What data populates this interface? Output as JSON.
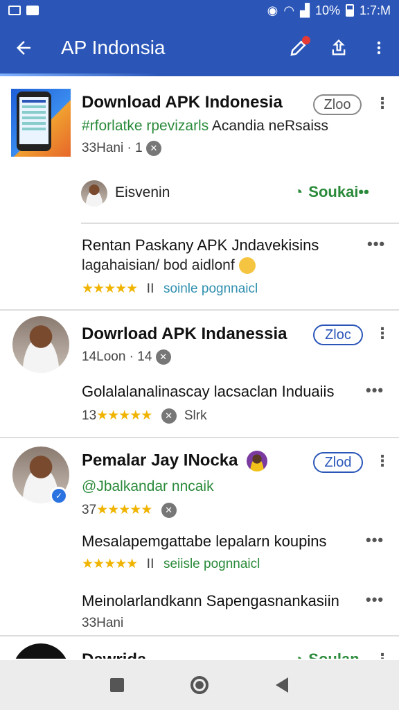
{
  "status_bar": {
    "battery": "10%",
    "time": "1:7:M"
  },
  "app_bar": {
    "title": "AP Indonsia",
    "back_icon": "arrow-left-icon",
    "actions": [
      "edit-icon",
      "share-icon",
      "more-vert-icon"
    ]
  },
  "items": {
    "first": {
      "title": "Download APK Indonesia",
      "tag": "Zloo",
      "subtitle_green": "#rforlatke rpevizarls",
      "subtitle_dark": "Acandia neRsaiss",
      "meta_left": "33Hani ·",
      "meta_num": "1",
      "author": "Eisvenin",
      "follow": "Soukai••"
    },
    "second": {
      "title": "Rentan Paskany APK Jndavekisins",
      "subtitle": "lagahaisian/ bod aidlonf",
      "stars_right": "ⅠⅠ",
      "stars_text": "soinle pognnaicl"
    },
    "third": {
      "title": "Dowrload APK  Indanessia",
      "tag": "Zloc",
      "meta_left": "14Loon ·",
      "meta_num": "14",
      "body": "Golalalanalinascay lacsaclan Induaiis",
      "rate_prefix": "13",
      "rate_suffix": "Slrk"
    },
    "fourth": {
      "title": "Pemalar Jay INocka",
      "tag": "Zlod",
      "handle": "@Jbalkandar nncaik",
      "rate_prefix": "37",
      "body1": "Mesalapemgattabe lepalarn koupins",
      "stars_right": "ⅠⅠ",
      "stars_text": "seiisle pognnaicl",
      "body2": "Meinolarlandkann Sapengasnankasiin",
      "meta2": "33Hani"
    },
    "fifth": {
      "title": "Dawrida",
      "follow": "Soulan"
    }
  },
  "more_dots": "•••",
  "kebab": "⋮",
  "stars": "★★★★★"
}
